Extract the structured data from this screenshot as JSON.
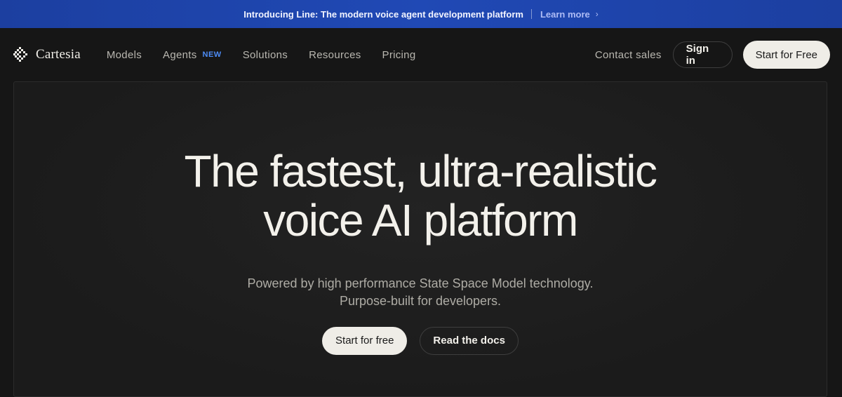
{
  "announcement": {
    "text": "Introducing Line: The modern voice agent development platform",
    "link_label": "Learn more",
    "chevron": "›"
  },
  "nav": {
    "logo_text": "Cartesia",
    "items": [
      {
        "label": "Models"
      },
      {
        "label": "Agents",
        "badge": "NEW"
      },
      {
        "label": "Solutions"
      },
      {
        "label": "Resources"
      },
      {
        "label": "Pricing"
      }
    ],
    "contact_label": "Contact sales",
    "signin_label": "Sign in",
    "start_label": "Start for Free"
  },
  "hero": {
    "title_line1": "The fastest, ultra-realistic",
    "title_line2": "voice AI platform",
    "subtitle_line1": "Powered by high performance State Space Model technology.",
    "subtitle_line2": "Purpose-built for developers.",
    "primary_cta": "Start for free",
    "secondary_cta": "Read the docs"
  },
  "icons": {
    "logo": "cartesia-logo-icon",
    "chevron": "chevron-right-icon"
  },
  "colors": {
    "announcement_bg": "#1f47b0",
    "badge": "#4d8cf5",
    "page_bg": "#161616",
    "button_light": "#efede7"
  }
}
